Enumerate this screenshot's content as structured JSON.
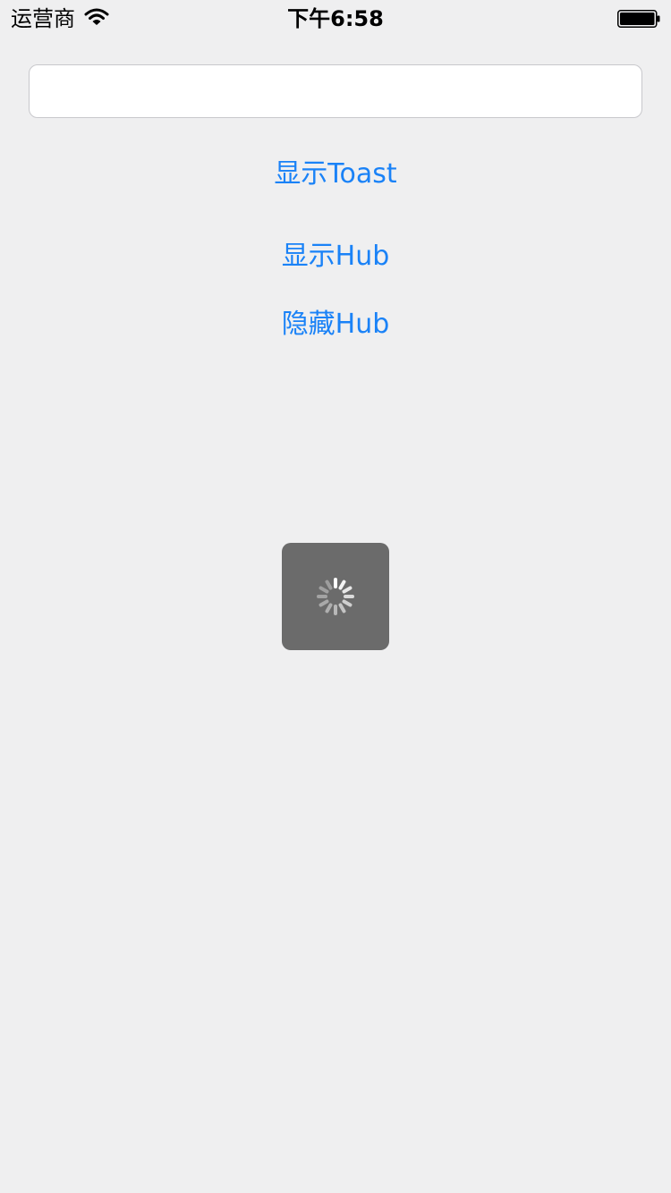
{
  "status_bar": {
    "carrier": "运营商",
    "time": "下午6:58",
    "icons": {
      "wifi": "wifi-icon",
      "battery": "battery-icon"
    }
  },
  "input": {
    "value": "",
    "placeholder": ""
  },
  "buttons": {
    "show_toast": "显示Toast",
    "show_hub": "显示Hub",
    "hide_hub": "隐藏Hub"
  },
  "hud": {
    "icon": "spinner-icon"
  },
  "colors": {
    "background": "#efeff0",
    "accent": "#1a82f7",
    "hud_background": "#6b6b6b",
    "field_border": "#c8c8cc"
  }
}
